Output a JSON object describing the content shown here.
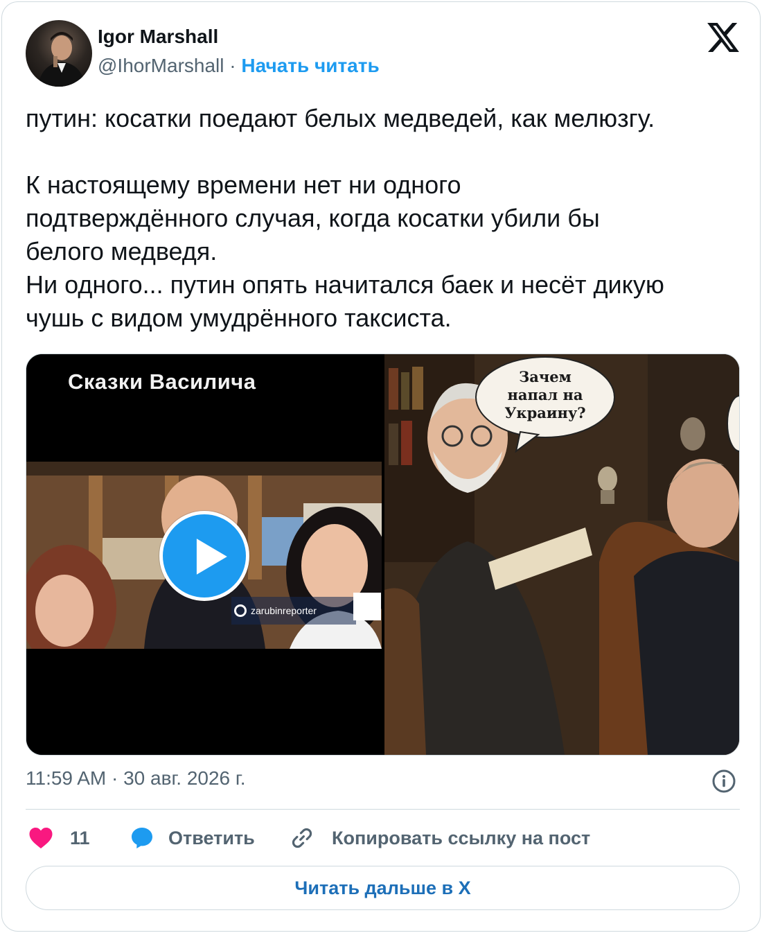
{
  "author": {
    "name": "Igor Marshall",
    "handle": "@IhorMarshall",
    "separator": "·",
    "follow_label": "Начать читать"
  },
  "tweet": {
    "paragraphs": [
      "путин: косатки поедают белых медведей, как мелюзгу.",
      "К настоящему времени нет ни одного",
      "подтверждённого случая, когда косатки убили бы",
      "белого медведя.",
      "Ни одного... путин опять начитался баек и несёт дикую",
      "чушь с видом умудрённого таксиста."
    ]
  },
  "media": {
    "video_title": "Сказки Василича",
    "watermark": "zarubinreporter",
    "speech_bubble": [
      "Зачем",
      "напал на",
      "Украину?"
    ]
  },
  "meta": {
    "timestamp": "11:59 AM · 30 авг. 2026 г."
  },
  "actions": {
    "likes": "11",
    "reply_label": "Ответить",
    "copy_label": "Копировать ссылку на пост",
    "read_more": "Читать дальше в X"
  },
  "colors": {
    "accent": "#1d9bf0",
    "like": "#f91880",
    "muted": "#536471",
    "border": "#cfd9de"
  },
  "icons": [
    "x-logo-icon",
    "play-icon",
    "heart-icon",
    "reply-bubble-icon",
    "link-icon",
    "info-icon"
  ]
}
